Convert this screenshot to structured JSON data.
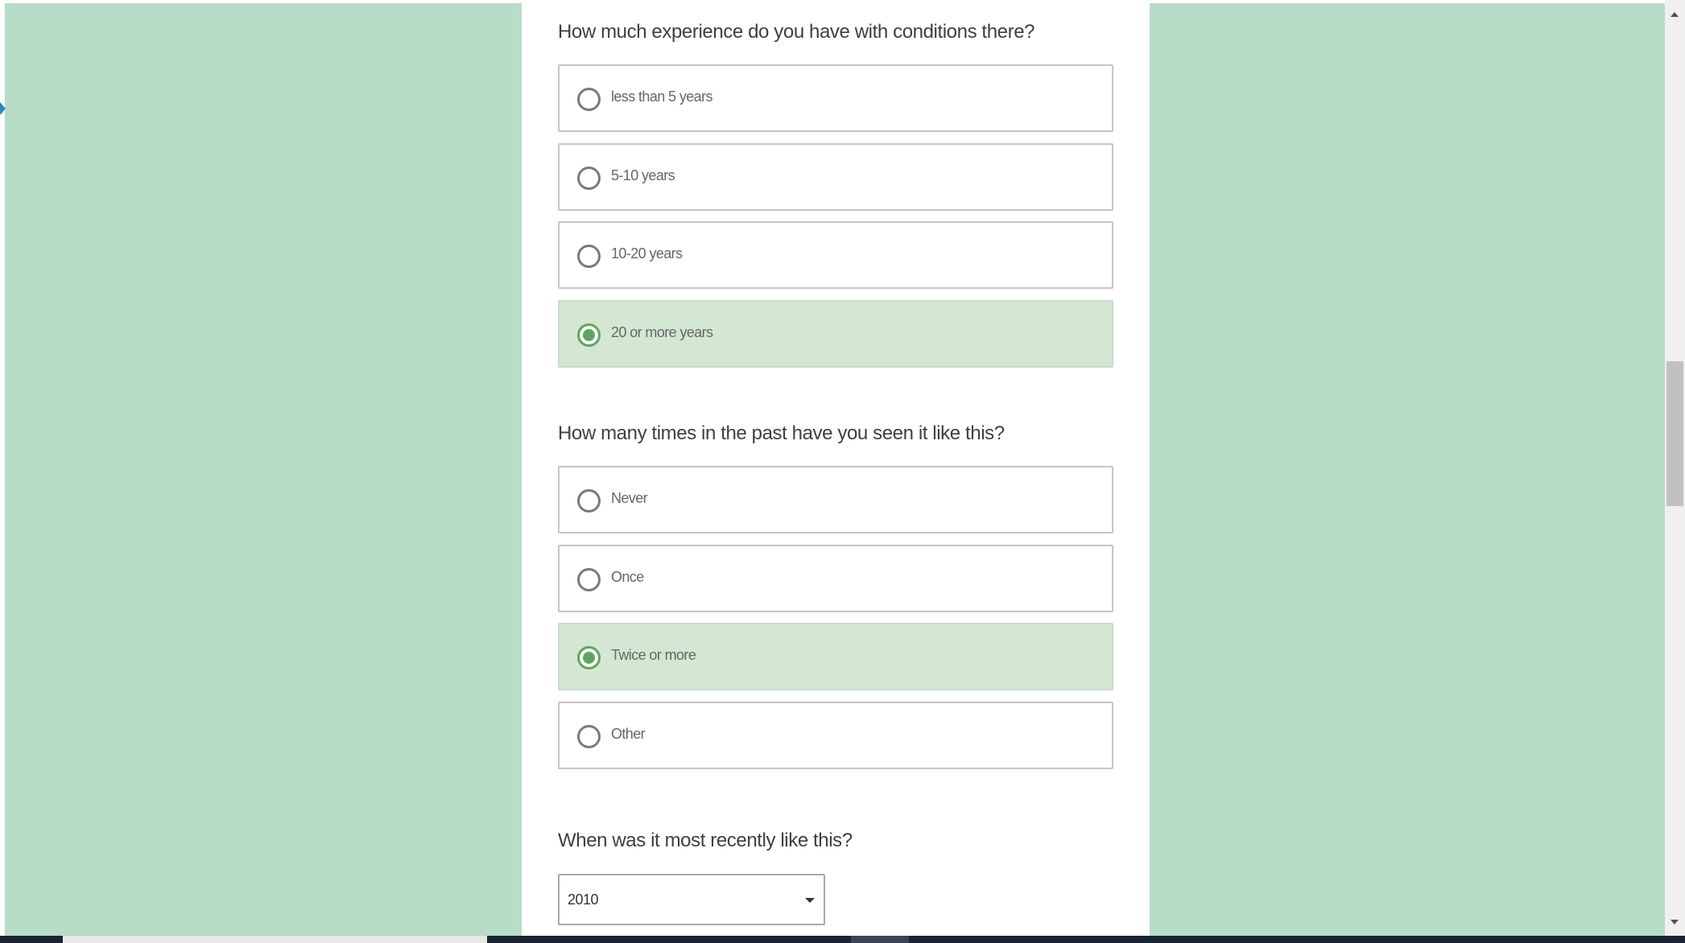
{
  "colors": {
    "page_bg": "#b7dcc8",
    "accent": "#5fa55f",
    "selected_bg": "#d4e7d2"
  },
  "questions": [
    {
      "text": "How much experience do you have with conditions there?",
      "options": [
        {
          "label": "less than 5 years",
          "selected": false
        },
        {
          "label": "5-10 years",
          "selected": false
        },
        {
          "label": "10-20 years",
          "selected": false
        },
        {
          "label": "20 or more years",
          "selected": true
        }
      ]
    },
    {
      "text": "How many times in the past have you seen it like this?",
      "options": [
        {
          "label": "Never",
          "selected": false
        },
        {
          "label": "Once",
          "selected": false
        },
        {
          "label": "Twice or more",
          "selected": true
        },
        {
          "label": "Other",
          "selected": false
        }
      ]
    },
    {
      "text": "When was it most recently like this?",
      "select_value": "2010",
      "icon": "chevron-down-icon"
    }
  ]
}
